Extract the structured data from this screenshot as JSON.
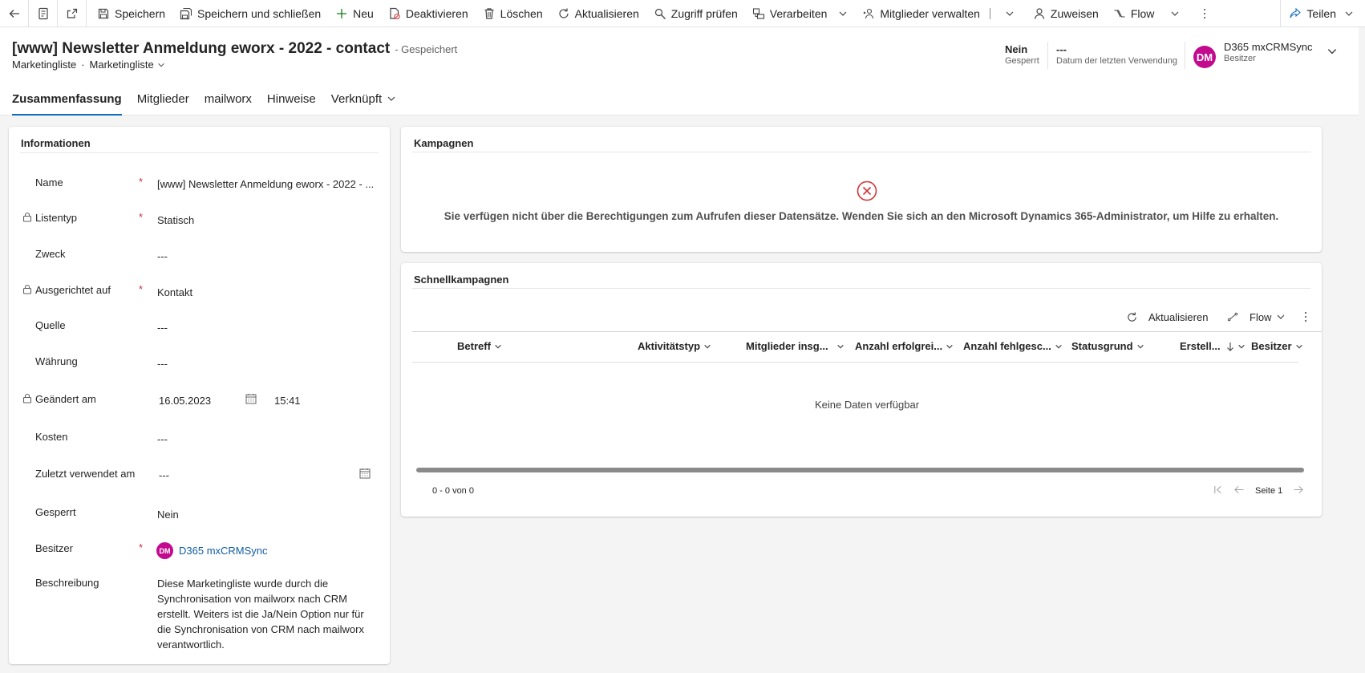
{
  "commandbar": {
    "save": "Speichern",
    "save_close": "Speichern und schließen",
    "new": "Neu",
    "deactivate": "Deaktivieren",
    "delete": "Löschen",
    "refresh": "Aktualisieren",
    "check_access": "Zugriff prüfen",
    "process": "Verarbeiten",
    "manage_members": "Mitglieder verwalten",
    "assign": "Zuweisen",
    "flow": "Flow",
    "share": "Teilen"
  },
  "header": {
    "title": "[www] Newsletter Anmeldung eworx - 2022 - contact",
    "save_status": "- Gespeichert",
    "entity": "Marketingliste",
    "form": "Marketingliste",
    "locked_value": "Nein",
    "locked_label": "Gesperrt",
    "last_used_value": "---",
    "last_used_label": "Datum der letzten Verwendung",
    "owner_initials": "DM",
    "owner_name": "D365 mxCRMSync",
    "owner_label": "Besitzer"
  },
  "tabs": [
    "Zusammenfassung",
    "Mitglieder",
    "mailworx",
    "Hinweise",
    "Verknüpft"
  ],
  "info": {
    "title": "Informationen",
    "name_label": "Name",
    "name_value": "[www] Newsletter Anmeldung eworx - 2022 - ...",
    "listtype_label": "Listentyp",
    "listtype_value": "Statisch",
    "purpose_label": "Zweck",
    "purpose_value": "---",
    "target_label": "Ausgerichtet auf",
    "target_value": "Kontakt",
    "source_label": "Quelle",
    "source_value": "---",
    "currency_label": "Währung",
    "currency_value": "---",
    "modified_label": "Geändert am",
    "modified_date": "16.05.2023",
    "modified_time": "15:41",
    "cost_label": "Kosten",
    "cost_value": "---",
    "lastused_label": "Zuletzt verwendet am",
    "lastused_value": "---",
    "locked_label": "Gesperrt",
    "locked_value": "Nein",
    "owner_label": "Besitzer",
    "owner_initials": "DM",
    "owner_value": "D365 mxCRMSync",
    "desc_label": "Beschreibung",
    "desc_lines": [
      "Diese Marketingliste wurde durch die",
      "Synchronisation von mailworx nach CRM",
      "erstellt. Weiters ist die Ja/Nein Option nur für",
      "die Synchronisation von CRM nach mailworx",
      "verantwortlich."
    ],
    "required_mark": "*"
  },
  "campaigns": {
    "title": "Kampagnen",
    "error": "Sie verfügen nicht über die Berechtigungen zum Aufrufen dieser Datensätze. Wenden Sie sich an den Microsoft Dynamics 365-Administrator, um Hilfe zu erhalten."
  },
  "quick": {
    "title": "Schnellkampagnen",
    "refresh": "Aktualisieren",
    "flow": "Flow",
    "columns": [
      "Betreff",
      "Aktivitätstyp",
      "Mitglieder insg...",
      "Anzahl erfolgrei...",
      "Anzahl fehlgesc...",
      "Statusgrund",
      "Erstell...",
      "Besitzer"
    ],
    "empty": "Keine Daten verfügbar",
    "count": "0 - 0 von 0",
    "page": "Seite 1"
  },
  "colors": {
    "accent": "#0f6cbd",
    "avatar": "#c30a8e",
    "error": "#d13438",
    "required": "#c4314b"
  }
}
